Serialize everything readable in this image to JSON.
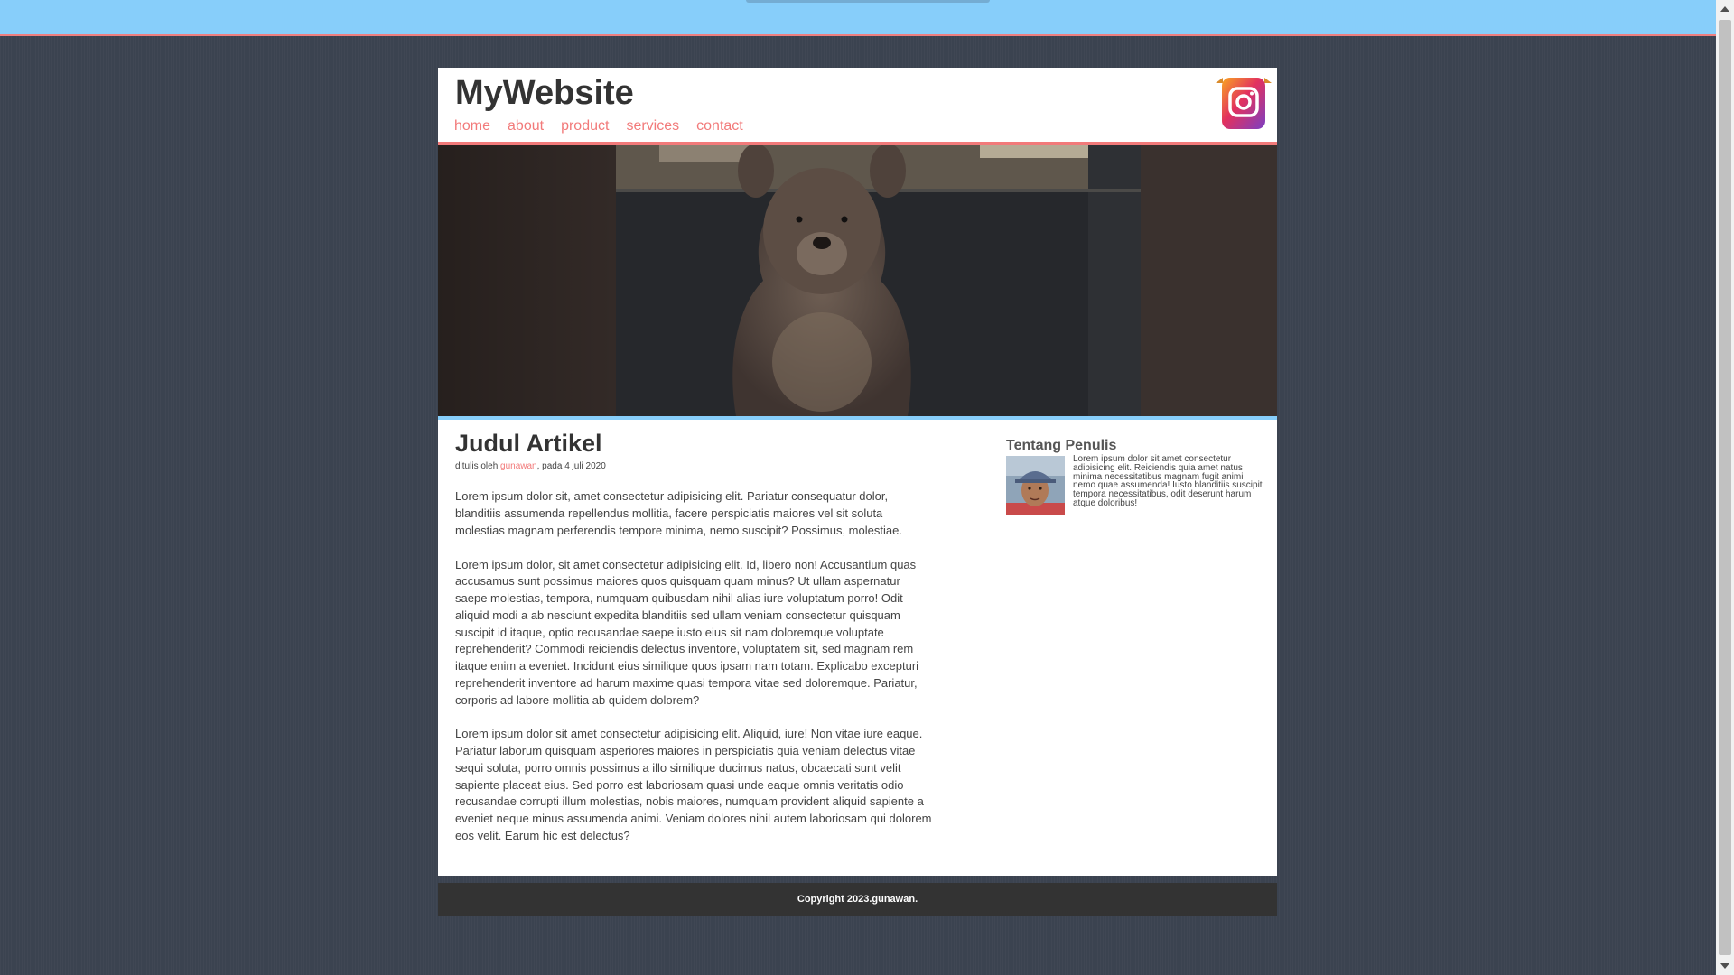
{
  "site": {
    "title": "MyWebsite",
    "nav": [
      "home",
      "about",
      "product",
      "services",
      "contact"
    ]
  },
  "hero": {
    "image": "bear-in-pickup-truck-photo"
  },
  "article": {
    "title": "Judul Artikel",
    "byline_prefix": "ditulis oleh ",
    "author": "gunawan",
    "byline_suffix": ", pada 4 juli 2020",
    "paragraphs": [
      "Lorem ipsum dolor sit, amet consectetur adipisicing elit. Pariatur consequatur dolor, blanditiis assumenda repellendus mollitia, facere perspiciatis maiores vel sit soluta molestias magnam perferendis tempore minima, nemo suscipit? Possimus, molestiae.",
      "Lorem ipsum dolor, sit amet consectetur adipisicing elit. Id, libero non! Accusantium quas accusamus sunt possimus maiores quos quisquam quam minus? Ut ullam aspernatur saepe molestias, tempora, numquam quibusdam nihil alias iure voluptatum porro! Odit aliquid modi a ab nesciunt expedita blanditiis sed ullam veniam consectetur quisquam suscipit id itaque, optio recusandae saepe iusto eius sit nam doloremque voluptate reprehenderit? Commodi reiciendis delectus inventore, voluptatem sit, sed magnam rem itaque enim a eveniet. Incidunt eius similique quos ipsam nam totam. Explicabo excepturi reprehenderit inventore ad harum maxime quasi tempora vitae sed doloremque. Pariatur, corporis ad labore mollitia ab quidem dolorem?",
      "Lorem ipsum dolor sit amet consectetur adipisicing elit. Aliquid, iure! Non vitae iure eaque. Pariatur laborum quisquam asperiores maiores in perspiciatis quia veniam delectus vitae sequi soluta, porro omnis possimus a illo similique ducimus natus, obcaecati sunt velit sapiente placeat eius. Sed porro est laboriosam quasi unde eaque omnis veritatis odio recusandae corrupti illum molestias, nobis maiores, numquam provident aliquid sapiente a eveniet neque minus assumenda animi. Veniam dolores nihil autem laboriosam qui dolorem eos velit. Earum hic est delectus?"
    ]
  },
  "sidebar": {
    "title": "Tentang Penulis",
    "bio": "Lorem ipsum dolor sit amet consectetur adipisicing elit. Reiciendis quia amet natus minima necessitatibus magnam fugit animi nemo quae assumenda! Iusto blanditiis suscipit tempora necessitatibus, odit deserunt harum atque doloribus!"
  },
  "footer": {
    "text": "Copyright 2023.gunawan."
  },
  "colors": {
    "accent": "#f27a7a",
    "topbar": "#87cefa",
    "footer_bg": "#333333",
    "page_bg": "#3b4350"
  },
  "icons": {
    "social": "instagram-icon"
  }
}
